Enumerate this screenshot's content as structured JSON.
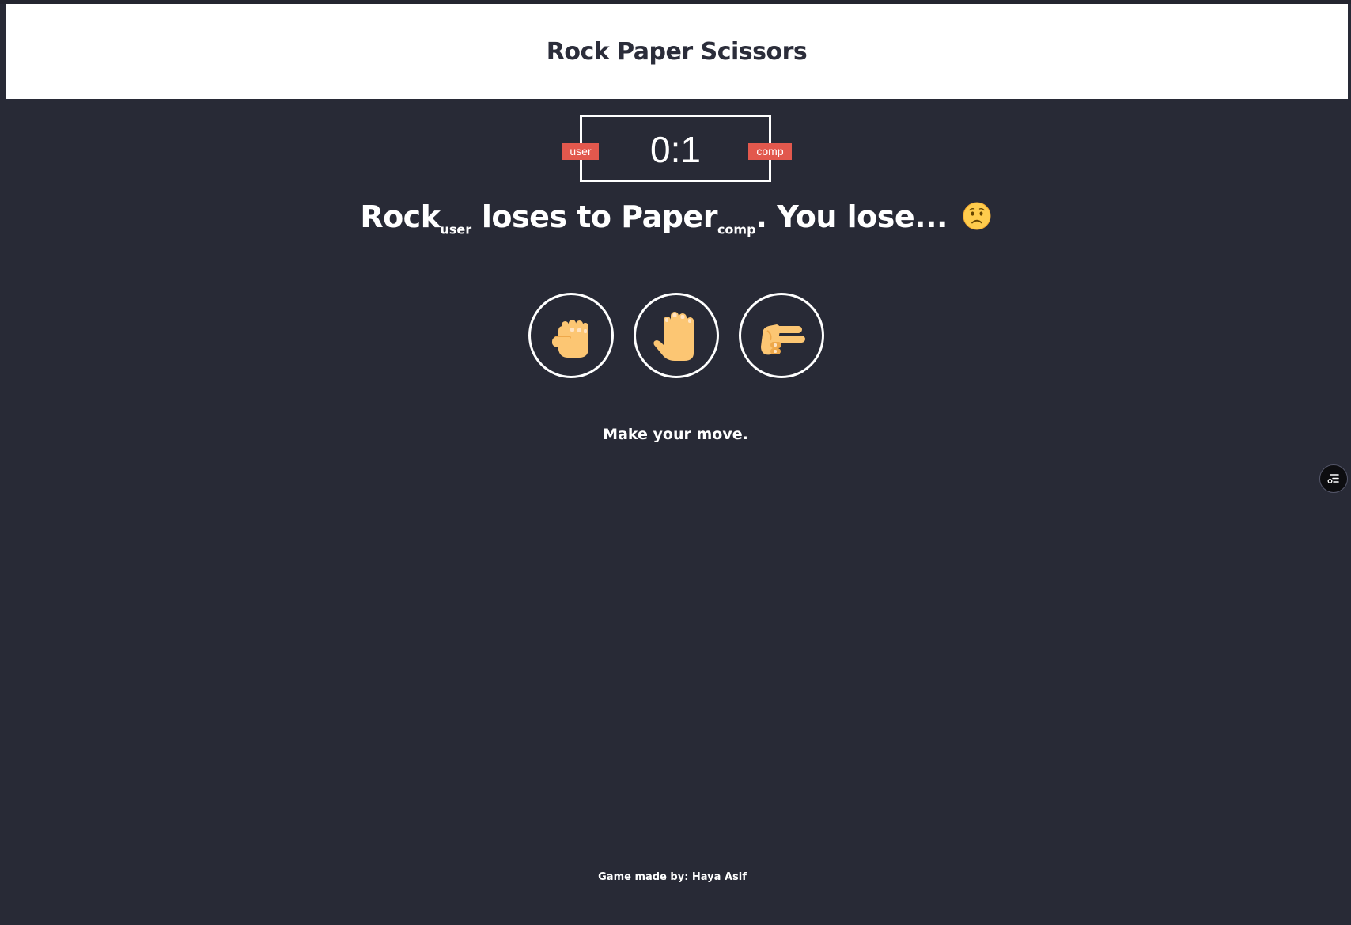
{
  "header": {
    "title": "Rock Paper Scissors"
  },
  "scoreboard": {
    "score": "0:1",
    "user_label": "user",
    "comp_label": "comp",
    "badge_color": "#e2584d"
  },
  "result": {
    "user_choice": "Rock",
    "user_tag": "user",
    "verb": " loses to ",
    "comp_choice": "Paper",
    "comp_tag": "comp",
    "outcome": ". You lose... ",
    "emoji_icon": "worried-face-icon"
  },
  "choices": [
    {
      "id": "rock",
      "icon": "raised-fist-icon"
    },
    {
      "id": "paper",
      "icon": "raised-hand-icon"
    },
    {
      "id": "scissors",
      "icon": "pointing-hand-icon"
    }
  ],
  "prompt": "Make your move.",
  "footer": {
    "credit": "Game made by: Haya Asif"
  },
  "floating_button": {
    "icon": "menu-list-icon"
  },
  "colors": {
    "background": "#282a36",
    "header_bg": "#ffffff",
    "header_text": "#2b2d3a",
    "hand_skin": "#fcc673",
    "hand_shade": "#eea84a"
  }
}
